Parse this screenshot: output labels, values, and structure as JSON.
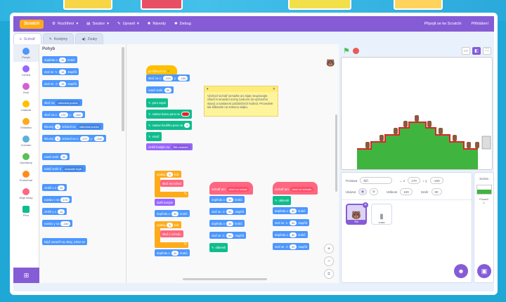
{
  "menubar": {
    "logo": "Scratch",
    "settings": "Rozšíření",
    "file": "Soubor",
    "edit": "Upravit",
    "tutorials": "Návody",
    "debug": "Debug",
    "join": "Připojit se ke Scratchi",
    "signin": "Přihlášení"
  },
  "tabs": {
    "code": "Scénář",
    "costumes": "Kostýmy",
    "sounds": "Zvuky"
  },
  "categories": [
    {
      "label": "Pohyb",
      "color": "#4c97ff"
    },
    {
      "label": "Vzhled",
      "color": "#9966ff"
    },
    {
      "label": "Zvuk",
      "color": "#cf63cf"
    },
    {
      "label": "Události",
      "color": "#ffbf00"
    },
    {
      "label": "Ovládání",
      "color": "#ffab19"
    },
    {
      "label": "Vnímání",
      "color": "#5cb1d6"
    },
    {
      "label": "Operátory",
      "color": "#59c059"
    },
    {
      "label": "Proměnné",
      "color": "#ff8c1a"
    },
    {
      "label": "Moje bloky",
      "color": "#ff6680"
    },
    {
      "label": "Pero",
      "color": "#0fbd8c"
    }
  ],
  "palette": {
    "title": "Pohyb",
    "b1": "dopředu o",
    "b1v": "10",
    "b1s": "kroků",
    "b2": "otoč se",
    "b2v": "15",
    "b2s": "stupňů",
    "b3": "otoč se",
    "b3v": "15",
    "b3s": "stupňů",
    "b4": "skoč na",
    "b4d": "náhodná pozice",
    "b5": "skoč na x:",
    "b5v": "170",
    "b5y": "y:",
    "b5w": "-160",
    "b6": "klouzej",
    "b6v": "1",
    "b6s": "sekund na",
    "b6d": "náhodná pozice",
    "b7": "klouzej",
    "b7v": "1",
    "b7s": "sekund na x:",
    "b7x": "170",
    "b7y": "y:",
    "b7w": "-160",
    "b8": "natoč směr",
    "b8v": "90",
    "b9": "natoč směr k",
    "b9d": "ukazatel myši",
    "b10": "změň x o",
    "b10v": "10",
    "b11": "nastav x na",
    "b11v": "170",
    "b12": "změň y o",
    "b12v": "10",
    "b13": "nastav y na",
    "b13v": "-160",
    "b14": "když narazíš na okraj, odraz se"
  },
  "script1": {
    "hat": "po kliknutí na",
    "s1": "skoč na x:",
    "s1x": "-220",
    "s1y": "y:",
    "s1w": "-160",
    "s2": "natoč směr",
    "s2v": "90",
    "s3": "pero zapni",
    "s4": "nastav barvu pera na",
    "s5": "nastav tloušťku pera na",
    "s5v": "5",
    "s6": "smaž",
    "s7": "změň kostým na",
    "s7d": "Šiři medvěd"
  },
  "script2": {
    "r1": "opakuj",
    "r1v": "5",
    "r1s": "krát",
    "c1": "skoč na schod",
    "c2": "další kostým",
    "c3": "dopředu o",
    "c3v": "30",
    "c3s": "kroků",
    "r2": "opakuj",
    "r2v": "5",
    "r2s": "krát",
    "c4": "skoč z schodu",
    "c5": "dopředu o",
    "c5v": "30",
    "c5s": "kroků"
  },
  "script3": {
    "def": "scénář pro",
    "defv": "skoč na schod",
    "a1": "dopředu o",
    "a1v": "30",
    "a1s": "kroků",
    "a2": "otoč se",
    "a2v": "90",
    "a2s": "stupňů",
    "a3": "dopředu o",
    "a3v": "30",
    "a3s": "kroků",
    "a4": "otoč se",
    "a4v": "90",
    "a4s": "stupňů",
    "a5": "obkresli"
  },
  "script4": {
    "def": "scénář pro",
    "defv": "skoč ze schodu",
    "a0": "obkresli",
    "a1": "dopředu o",
    "a1v": "30",
    "a1s": "kroků",
    "a2": "otoč se",
    "a2v": "90",
    "a2s": "stupňů",
    "a3": "dopředu o",
    "a3v": "30",
    "a3s": "kroků",
    "a4": "otoč se",
    "a4v": "90",
    "a4s": "stupňů"
  },
  "note": "Výchozí scénář nemažte ani nijak neupravujte. Slouží k smazání scény (vrácení do výchozího stavu) a nastavení počátečních hodnot. Provedete tak kliknutím na zelenou vlajku.",
  "sprite": {
    "label_sprite": "Postava",
    "name": "Šiři",
    "x": "170",
    "y": "-160",
    "label_show": "Ukázat",
    "label_size": "Velikost",
    "size": "100",
    "label_dir": "Směr",
    "dir": "90",
    "thumb1": "Šiři",
    "thumb2": "vrata"
  },
  "stagepanel": {
    "title": "Scéna",
    "bg_label": "Pozadí",
    "bg_count": "1"
  }
}
